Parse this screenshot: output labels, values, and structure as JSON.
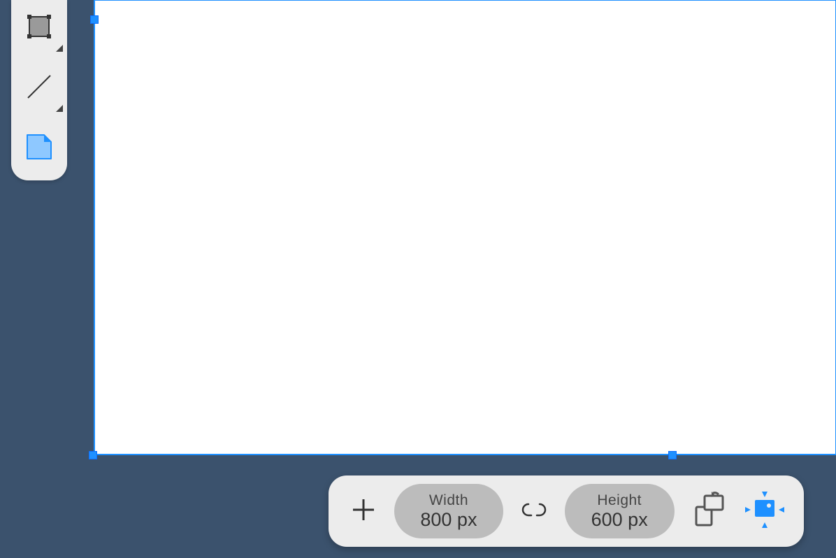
{
  "canvas": {
    "selection_color": "#1e90ff"
  },
  "side_toolbar": {
    "tools": [
      {
        "name": "rectangle-select-tool",
        "has_submenu": true
      },
      {
        "name": "line-tool",
        "has_submenu": true
      },
      {
        "name": "artboard-tool",
        "has_submenu": false,
        "active": true
      }
    ]
  },
  "control_bar": {
    "add_button": "add",
    "width": {
      "label": "Width",
      "value": "800 px"
    },
    "height": {
      "label": "Height",
      "value": "600 px"
    },
    "link_aspect": "unlinked",
    "orientation_button": "swap-orientation",
    "fit_button": "resize-image-to-fit"
  }
}
